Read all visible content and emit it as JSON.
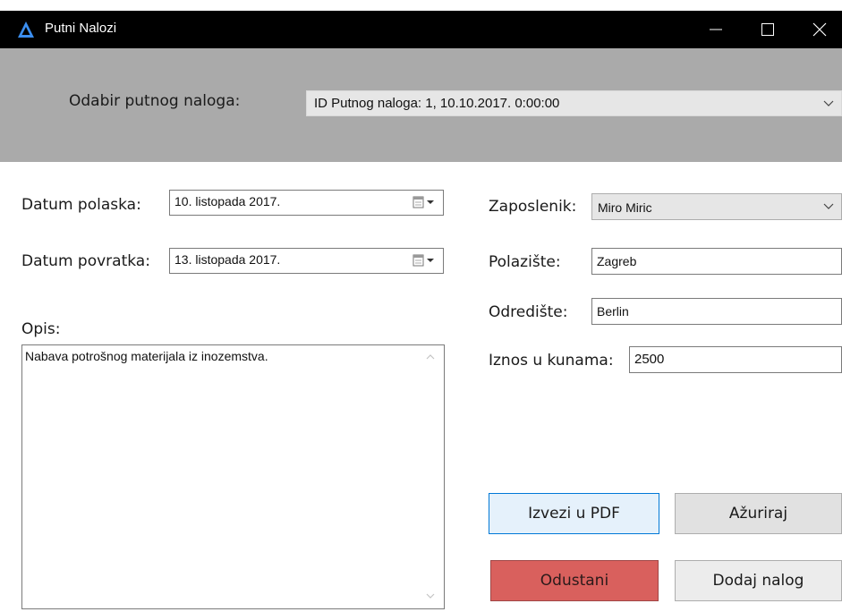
{
  "window": {
    "title": "Putni Nalozi",
    "icon": "delta-icon",
    "accent_color": "#3b8ef0"
  },
  "header": {
    "select_label": "Odabir putnog naloga:",
    "selected_order": "ID Putnog naloga: 1, 10.10.2017. 0:00:00"
  },
  "form": {
    "departure_label": "Datum polaska:",
    "departure_value": "10. listopada 2017.",
    "return_label": "Datum povratka:",
    "return_value": "13. listopada 2017.",
    "description_label": "Opis:",
    "description_value": "Nabava potrošnog materijala iz inozemstva.",
    "employee_label": "Zaposlenik:",
    "employee_value": "Miro Miric",
    "origin_label": "Polazište:",
    "origin_value": "Zagreb",
    "destination_label": "Odredište:",
    "destination_value": "Berlin",
    "amount_label": "Iznos u kunama:",
    "amount_value": "2500"
  },
  "actions": {
    "export_pdf": "Izvezi u PDF",
    "update": "Ažuriraj",
    "cancel": "Odustani",
    "add_order": "Dodaj nalog",
    "cancel_color": "#d9605d"
  }
}
